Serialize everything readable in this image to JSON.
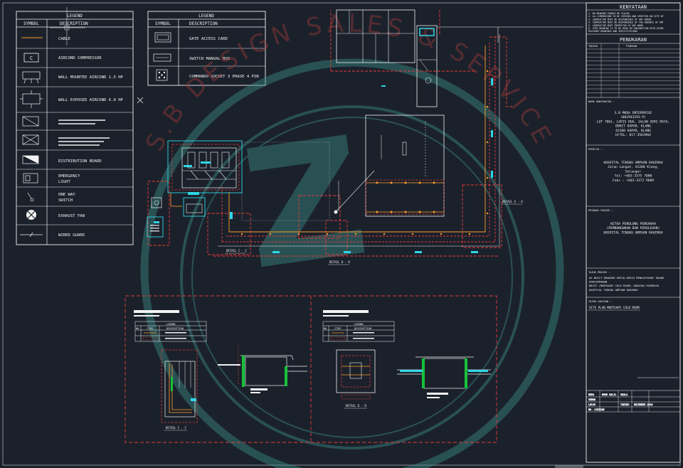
{
  "legend_left": {
    "title": "LEGEND",
    "col_symbol": "SYMBOL",
    "col_desc": "DESCRIPTION",
    "rows": [
      {
        "icon": "cable-line-icon",
        "desc1": "CABLE",
        "desc2": ""
      },
      {
        "icon": "aircond-compressor-icon",
        "symbol_text": "C",
        "desc1": "AIRCOND COMPRESSOR",
        "desc2": ""
      },
      {
        "icon": "wall-mounted-aircond-icon",
        "desc1": "WALL MOUNTED AIRCOND 1.5 HP",
        "desc2": ""
      },
      {
        "icon": "wall-exposed-aircond-icon",
        "desc1": "WALL EXPOSED AIRCOND 6.0 HP",
        "desc2": ""
      },
      {
        "icon": "socket-outlet-icon",
        "desc1": "",
        "desc2": ""
      },
      {
        "icon": "switch-socket-icon",
        "desc1": "",
        "desc2": ""
      },
      {
        "icon": "distribution-board-icon",
        "desc1": "DISTRIBUTION BOARD",
        "desc2": ""
      },
      {
        "icon": "emergency-light-icon",
        "desc1": "EMERGENCY",
        "desc2": "LIGHT"
      },
      {
        "icon": "one-way-switch-icon",
        "desc1": "ONE WAY",
        "desc2": "SWITCH"
      },
      {
        "icon": "exhaust-fan-icon",
        "desc1": "EXHAUST FAN",
        "desc2": ""
      },
      {
        "icon": "wired-guard-icon",
        "desc1": "WIRED GUARD",
        "desc2": ""
      }
    ]
  },
  "legend_right": {
    "title": "LEGEND",
    "col_symbol": "SYMBOL",
    "col_desc": "DESCRIPTION",
    "rows": [
      {
        "icon": "gate-access-card-icon",
        "desc": "GATE ACCESS CARD"
      },
      {
        "icon": "switch-manual-box-icon",
        "desc": "SWITCH MANUAL BOX"
      },
      {
        "icon": "commando-socket-icon",
        "desc": "COMMANDO SOCKET 3 PHASE 4 PIN"
      }
    ]
  },
  "details": {
    "c_label": "DETAIL C - C",
    "d_label": "DETAIL D - D",
    "e_label": "DETAIL E - E",
    "panel_c_label": "DETAIL C - C",
    "panel_d_label": "DETAIL D - D",
    "panel_legend_title": "LEGEND",
    "panel_col_no": "NO",
    "panel_col_item": "ITEM",
    "panel_col_desc": "DESCRIPTION"
  },
  "title_block": {
    "kenyataan_title": "KENYATAAN",
    "kenyataan_lines": [
      "1.  NO DRAWING SHOULD BE SCALED",
      "2.  ALL DIMENSIONS TO BE CHECKED AND VERIFIED ON SITE BY",
      "3.  CONTRACTOR MUST BE RESPONSIBLE OF ANY ERROR",
      "4.  CONTRACTOR MUST BE RESPONSIBLE OF THE ABSENCE OF ANY",
      "5.  CONTRACTOR MUST INSPECTOR OF ANY WORK",
      "6.  THIS DRAWING IS TO BE READ IN CONJUNCTION WITH OTHER",
      "    RELEVANT DRAWINGS AND SPECIFICATIONS"
    ],
    "pindaan_title": "PENUKARAN",
    "pindaan_col1": "TARIKH",
    "pindaan_col2": "PINDAAN",
    "sub_contractor_label": "NAMA KONTRAKTOR :",
    "sub_contractor_lines": [
      "S.B MUDA ENTERPRISE",
      "(002943293-P)",
      "LOT 7061, LAPIS DUA, JALAN SERI RAYA,",
      "BUKIT KAPAR, KLANG",
      "42200 KAPAR, KLANG",
      "H/TEL: 017-3563964"
    ],
    "client_label": "PEMILIK :",
    "client_lines": [
      "HOSPITAL TENGKU AMPUAN RAHIMAH",
      "Jalan Langat, 41200 Klang,",
      "Selangor",
      "Tel: +603-3375 7000",
      "Faks : +603-3372 9689"
    ],
    "project_owner_label": "PEGAWAI PROJEK :",
    "project_owner_lines": [
      "KETUA PENOLONG PENGARAH",
      "(PEMBANGUNAN DAN PEROLEHAN)",
      "HOSPITAL TENGKU AMPUAN RAHIMAH"
    ],
    "project_title_label": "TAJUK PROJEK :",
    "project_title_lines": [
      "AS BUILT DRAWING KERJA-KERJA MENAIKTARAF RUANG",
      "PENYIMPANAN",
      "MAYAT (MORTUARY COLD ROOM) JABATAN FORENSIK",
      "HOSPITAL TENGKU AMPUAN RAHIMAH"
    ],
    "drawing_title_label": "TAJUK LUKISAN :",
    "drawing_title": "SITE PLAN MORTUARY COLD ROOM",
    "meta": [
      {
        "k": "REKA",
        "v": "MOHD HALIL",
        "k2": "SKALA",
        "v2": ""
      },
      {
        "k": "SEMAK",
        "v": "",
        "k2": "",
        "v2": ""
      },
      {
        "k": "LULUS",
        "v": "",
        "k2": "TARIKH",
        "v2": "DECEMBER 2018"
      },
      {
        "k": "NO. LUKISAN",
        "v": "",
        "k2": "",
        "v2": ""
      }
    ]
  },
  "watermark": {
    "text": "S.B DESIGN SALES & SERVICES",
    "letter": "Z"
  },
  "colors": {
    "bg": "#1b212b",
    "line": "#f2f2f2",
    "red": "#e53a3a",
    "orange": "#ff9d2a",
    "cyan": "#2fd6e6",
    "watermark": "#3a8b86"
  }
}
